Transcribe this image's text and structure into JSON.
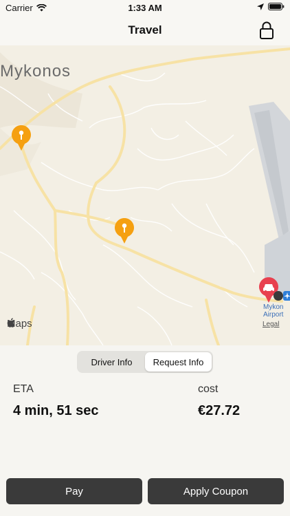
{
  "status": {
    "carrier": "Carrier",
    "time": "1:33 AM"
  },
  "nav": {
    "title": "Travel"
  },
  "map": {
    "town_label": "Mykonos",
    "airport_label_line1": "Mykon",
    "airport_label_line2": "Airport",
    "maps_logo": "Maps",
    "legal": "Legal"
  },
  "segment": {
    "items": [
      "Driver Info",
      "Request Info"
    ],
    "selected": "Request Info"
  },
  "info": {
    "eta_label": "ETA",
    "eta_value": "4 min, 51 sec",
    "cost_label": "cost",
    "cost_value": "€27.72"
  },
  "actions": {
    "pay": "Pay",
    "coupon": "Apply Coupon"
  },
  "colors": {
    "pin": "#f5a011",
    "car_pin": "#e8404f",
    "button": "#3a3a3a",
    "road": "#f7e2a5"
  }
}
